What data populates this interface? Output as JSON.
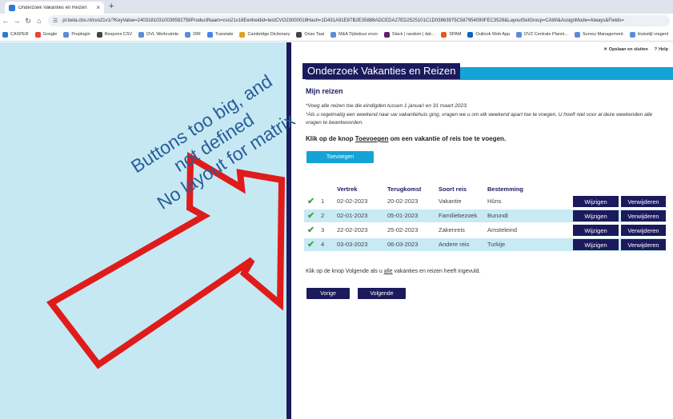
{
  "browser": {
    "tab_title": "Onderzoek Vakanties en Reizen",
    "tab_close": "×",
    "new_tab": "+",
    "url": "pt.beta.cbs.nl/cvo21v1/?KeyValue=24031810310039592758ProductNaam=cvo21v18Eenheidid=testCVO23000018Hash=1D431A91E87B2E35888ADCEDA27ED2525101C1D03863975C587954090FEC3529&LayoutSetGroup=CAWI&AssignMode=Always&Fields=",
    "bookmarks": [
      "CASPER",
      "Google",
      "Preplogin",
      "Respons CSV",
      "DVL Werkruimte",
      "DRI",
      "Translate",
      "Cambridge Dictionary",
      "Onze Taal",
      "M&A Tijdsduur enzo",
      "Slack | random | dat...",
      "SPAM",
      "Outlook Web App",
      "DVZ Centrale Planni...",
      "Survey Management",
      "Huisstijl vragenl"
    ]
  },
  "page": {
    "links": {
      "save_close": "Opslaan en sluiten",
      "help": "Help"
    },
    "title": "Onderzoek Vakanties en Reizen",
    "section_heading": "Mijn reizen",
    "note1": "*Voeg alle reizen toe die eindigden tussen 1 januari en 31 maart 2023.",
    "note2": "*Als u regelmatig een weekend naar uw vakantiehuis ging, vragen we u om elk weekend apart toe te voegen. U hoeft niet voor al deze weekenden alle vragen te beantwoorden.",
    "klik_prefix": "Klik op de knop ",
    "klik_link": "Toevoegen",
    "klik_suffix": " om een vakantie of reis toe te voegen.",
    "add_button": "Toevoegen",
    "columns": {
      "vertrek": "Vertrek",
      "terugkomst": "Terugkomst",
      "soort": "Soort reis",
      "bestemming": "Bestemming"
    },
    "rows": [
      {
        "n": "1",
        "vertrek": "02-02-2023",
        "terugkomst": "20-02-2023",
        "soort": "Vakantie",
        "bestemming": "Hûns"
      },
      {
        "n": "2",
        "vertrek": "02-01-2023",
        "terugkomst": "05-01-2023",
        "soort": "Familiebezoek",
        "bestemming": "Burundi"
      },
      {
        "n": "3",
        "vertrek": "22-02-2023",
        "terugkomst": "25-02-2023",
        "soort": "Zakenreis",
        "bestemming": "Amsteleind"
      },
      {
        "n": "4",
        "vertrek": "03-03-2023",
        "terugkomst": "06-03-2023",
        "soort": "Andere reis",
        "bestemming": "Turkije"
      }
    ],
    "edit_label": "Wijzigen",
    "delete_label": "Verwijderen",
    "bottom_prefix": "Klik op de knop Volgende als u ",
    "bottom_link": "alle",
    "bottom_suffix": " vakanties en reizen heeft ingevuld.",
    "prev_button": "Vorige",
    "next_button": "Volgende"
  },
  "annotation": {
    "line1": "Buttons too big, and",
    "line2": "not defined",
    "line3": "No layout for matrix",
    "arrow_color": "#e01b1b"
  }
}
